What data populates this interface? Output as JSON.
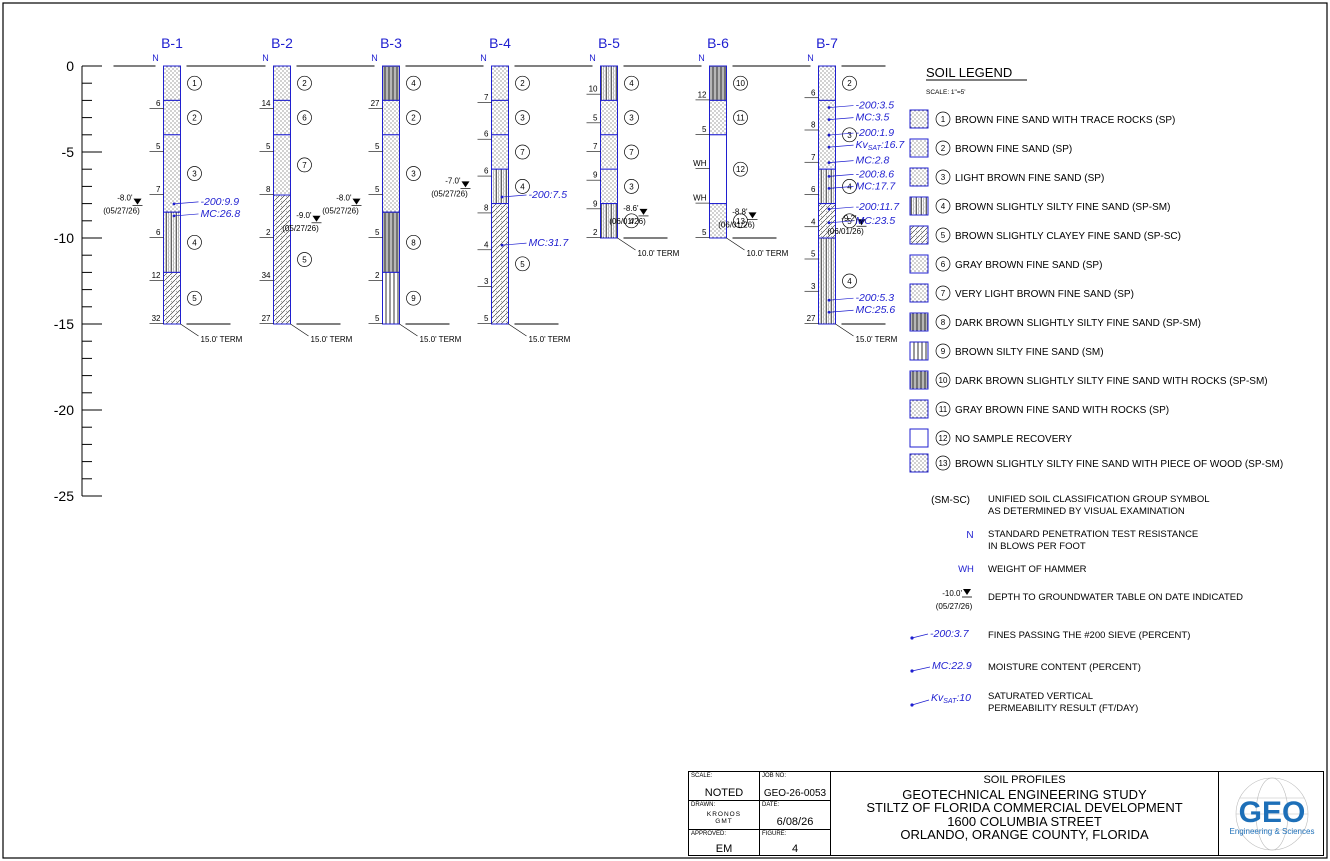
{
  "borings": [
    {
      "id": "B-1",
      "n": [
        "6",
        "5",
        "7",
        "6",
        "12",
        "32"
      ],
      "water": {
        "depth": "-8.0'",
        "date": "(05/27/26)"
      },
      "term": "15.0' TERM",
      "layers": [
        {
          "num": "1",
          "from": 0,
          "to": 2,
          "pattern": "sand"
        },
        {
          "num": "2",
          "from": 2,
          "to": 4,
          "pattern": "sand"
        },
        {
          "num": "3",
          "from": 4,
          "to": 8.5,
          "pattern": "sand"
        },
        {
          "num": "4",
          "from": 8.5,
          "to": 12,
          "pattern": "siltysand"
        },
        {
          "num": "5",
          "from": 12,
          "to": 15,
          "pattern": "clayey"
        }
      ],
      "lab": [
        {
          "text": "-200:9.9",
          "depth": 7.9
        },
        {
          "text": "MC:26.8",
          "depth": 8.6
        }
      ]
    },
    {
      "id": "B-2",
      "n": [
        "14",
        "5",
        "8",
        "2",
        "34",
        "27"
      ],
      "water": {
        "depth": "-9.0'",
        "date": "(05/27/26)"
      },
      "term": "15.0' TERM",
      "layers": [
        {
          "num": "2",
          "from": 0,
          "to": 2,
          "pattern": "sand"
        },
        {
          "num": "6",
          "from": 2,
          "to": 4,
          "pattern": "sand"
        },
        {
          "num": "7",
          "from": 4,
          "to": 7.5,
          "pattern": "sand"
        },
        {
          "num": "5",
          "from": 7.5,
          "to": 15,
          "pattern": "clayey"
        }
      ],
      "lab": []
    },
    {
      "id": "B-3",
      "n": [
        "27",
        "5",
        "5",
        "5",
        "2",
        "5"
      ],
      "water": {
        "depth": "-8.0'",
        "date": "(05/27/26)"
      },
      "term": "15.0' TERM",
      "layers": [
        {
          "num": "4",
          "from": 0,
          "to": 2,
          "pattern": "darksilt"
        },
        {
          "num": "2",
          "from": 2,
          "to": 4,
          "pattern": "sand"
        },
        {
          "num": "3",
          "from": 4,
          "to": 8.5,
          "pattern": "sand"
        },
        {
          "num": "8",
          "from": 8.5,
          "to": 12,
          "pattern": "darksilt"
        },
        {
          "num": "9",
          "from": 12,
          "to": 15,
          "pattern": "silt"
        }
      ],
      "lab": []
    },
    {
      "id": "B-4",
      "n": [
        "7",
        "6",
        "6",
        "8",
        "4",
        "3",
        "5"
      ],
      "water": {
        "depth": "-7.0'",
        "date": "(05/27/26)"
      },
      "term": "15.0' TERM",
      "layers": [
        {
          "num": "2",
          "from": 0,
          "to": 2,
          "pattern": "sand"
        },
        {
          "num": "3",
          "from": 2,
          "to": 4,
          "pattern": "sand"
        },
        {
          "num": "7",
          "from": 4,
          "to": 6,
          "pattern": "sand"
        },
        {
          "num": "4",
          "from": 6,
          "to": 8,
          "pattern": "siltysand"
        },
        {
          "num": "5",
          "from": 8,
          "to": 15,
          "pattern": "clayey"
        }
      ],
      "lab": [
        {
          "text": "-200:7.5",
          "depth": 7.5
        },
        {
          "text": "MC:31.7",
          "depth": 10.3
        }
      ]
    },
    {
      "id": "B-5",
      "n": [
        "10",
        "5",
        "7",
        "9",
        "9",
        "2"
      ],
      "water": {
        "depth": "-8.6'",
        "date": "(06/01/26)"
      },
      "term": "10.0' TERM",
      "layers": [
        {
          "num": "4",
          "from": 0,
          "to": 2,
          "pattern": "siltysand"
        },
        {
          "num": "3",
          "from": 2,
          "to": 4,
          "pattern": "sand"
        },
        {
          "num": "7",
          "from": 4,
          "to": 6,
          "pattern": "sand"
        },
        {
          "num": "3",
          "from": 6,
          "to": 8,
          "pattern": "sand"
        },
        {
          "num": "4",
          "from": 8,
          "to": 10,
          "pattern": "siltysand"
        }
      ],
      "lab": []
    },
    {
      "id": "B-6",
      "n": [
        "12",
        "5",
        "WH",
        "WH",
        "5"
      ],
      "water": {
        "depth": "-8.8'",
        "date": "(06/01/26)"
      },
      "term": "10.0' TERM",
      "layers": [
        {
          "num": "10",
          "from": 0,
          "to": 2,
          "pattern": "darksilt"
        },
        {
          "num": "11",
          "from": 2,
          "to": 4,
          "pattern": "sand"
        },
        {
          "num": "12",
          "from": 4,
          "to": 8,
          "pattern": "none"
        },
        {
          "num": "13",
          "from": 8,
          "to": 10,
          "pattern": "sand"
        }
      ],
      "lab": []
    },
    {
      "id": "B-7",
      "n": [
        "6",
        "8",
        "7",
        "6",
        "4",
        "5",
        "3",
        "27"
      ],
      "water": {
        "depth": "-9.2'",
        "date": "(06/01/26)"
      },
      "term": "15.0' TERM",
      "layers": [
        {
          "num": "2",
          "from": 0,
          "to": 2,
          "pattern": "sand"
        },
        {
          "num": "3",
          "from": 2,
          "to": 6,
          "pattern": "sand"
        },
        {
          "num": "4",
          "from": 6,
          "to": 8,
          "pattern": "siltysand"
        },
        {
          "num": "5",
          "from": 8,
          "to": 10,
          "pattern": "clayey"
        },
        {
          "num": "4",
          "from": 10,
          "to": 15,
          "pattern": "siltysand"
        }
      ],
      "lab": [
        {
          "text": "-200:3.5",
          "depth": 2.3
        },
        {
          "text": "MC:3.5",
          "depth": 3.0
        },
        {
          "text": "-200:1.9",
          "depth": 3.9
        },
        {
          "text": "Kv",
          "sub": "SAT",
          "after": ":16.7",
          "depth": 4.6
        },
        {
          "text": "MC:2.8",
          "depth": 5.5
        },
        {
          "text": "-200:8.6",
          "depth": 6.3
        },
        {
          "text": "MC:17.7",
          "depth": 7.0
        },
        {
          "text": "-200:11.7",
          "depth": 8.2
        },
        {
          "text": "MC:23.5",
          "depth": 9.0
        },
        {
          "text": "-200:5.3",
          "depth": 13.5
        },
        {
          "text": "MC:25.6",
          "depth": 14.2
        }
      ]
    }
  ],
  "axis": {
    "ticks": [
      "0",
      "-5",
      "-10",
      "-15",
      "-20",
      "-25"
    ],
    "n_label": "N"
  },
  "legend": {
    "title": "SOIL LEGEND",
    "scale": "SCALE: 1\"=5'",
    "soils": [
      {
        "num": "1",
        "text": "BROWN FINE SAND WITH TRACE ROCKS (SP)",
        "pattern": "sand"
      },
      {
        "num": "2",
        "text": "BROWN FINE SAND (SP)",
        "pattern": "sand"
      },
      {
        "num": "3",
        "text": "LIGHT BROWN FINE SAND (SP)",
        "pattern": "sand"
      },
      {
        "num": "4",
        "text": "BROWN SLIGHTLY SILTY FINE SAND (SP-SM)",
        "pattern": "siltysand"
      },
      {
        "num": "5",
        "text": "BROWN SLIGHTLY CLAYEY FINE SAND (SP-SC)",
        "pattern": "clayey"
      },
      {
        "num": "6",
        "text": "GRAY BROWN FINE SAND (SP)",
        "pattern": "sand"
      },
      {
        "num": "7",
        "text": "VERY LIGHT BROWN FINE SAND (SP)",
        "pattern": "sand"
      },
      {
        "num": "8",
        "text": "DARK BROWN SLIGHTLY SILTY FINE SAND (SP-SM)",
        "pattern": "darksilt"
      },
      {
        "num": "9",
        "text": "BROWN SILTY FINE SAND (SM)",
        "pattern": "silt"
      },
      {
        "num": "10",
        "text": "DARK BROWN SLIGHTLY SILTY FINE SAND WITH ROCKS (SP-SM)",
        "pattern": "darksilt"
      },
      {
        "num": "11",
        "text": "GRAY BROWN FINE SAND WITH ROCKS (SP)",
        "pattern": "sand"
      },
      {
        "num": "12",
        "text": "NO SAMPLE RECOVERY",
        "pattern": "none"
      },
      {
        "num": "13",
        "text": "BROWN SLIGHTLY SILTY FINE SAND WITH PIECE OF WOOD (SP-SM)",
        "pattern": "sand"
      }
    ],
    "symbols": {
      "uscs": {
        "sym": "(SM-SC)",
        "l1": "UNIFIED SOIL CLASSIFICATION GROUP SYMBOL",
        "l2": "AS DETERMINED BY VISUAL EXAMINATION"
      },
      "n": {
        "sym": "N",
        "l1": "STANDARD PENETRATION TEST RESISTANCE",
        "l2": "IN BLOWS PER FOOT"
      },
      "wh": {
        "sym": "WH",
        "l1": "WEIGHT OF HAMMER"
      },
      "water": {
        "depth": "-10.0'",
        "date": "(05/27/26)",
        "l1": "DEPTH TO GROUNDWATER TABLE ON DATE INDICATED"
      },
      "fines": {
        "sym": "-200:3.7",
        "l1": "FINES PASSING THE #200 SIEVE (PERCENT)"
      },
      "mc": {
        "sym": "MC:22.9",
        "l1": "MOISTURE CONTENT (PERCENT)"
      },
      "kv": {
        "sym": "Kv",
        "sub": "SAT",
        "after": ":10",
        "l1": "SATURATED VERTICAL",
        "l2": "PERMEABILITY RESULT (FT/DAY)"
      }
    }
  },
  "titleblock": {
    "scale_label": "SCALE:",
    "scale": "NOTED",
    "job_label": "JOB NO:",
    "job": "GEO-26-0053",
    "drawn_label": "DRAWN:",
    "drawn": "KRONOS GMT",
    "date_label": "DATE:",
    "date": "6/08/26",
    "approved_label": "APPROVED:",
    "approved": "EM",
    "figure_label": "FIGURE:",
    "figure": "4",
    "title": "SOIL PROFILES",
    "l1": "GEOTECHNICAL ENGINEERING STUDY",
    "l2": "STILTZ OF FLORIDA COMMERCIAL DEVELOPMENT",
    "l3": "1600 COLUMBIA STREET",
    "l4": "ORLANDO, ORANGE COUNTY, FLORIDA",
    "logo": "GEO",
    "logo_sub": "Engineering & Sciences",
    "logo_color": "#1d6fb8"
  }
}
